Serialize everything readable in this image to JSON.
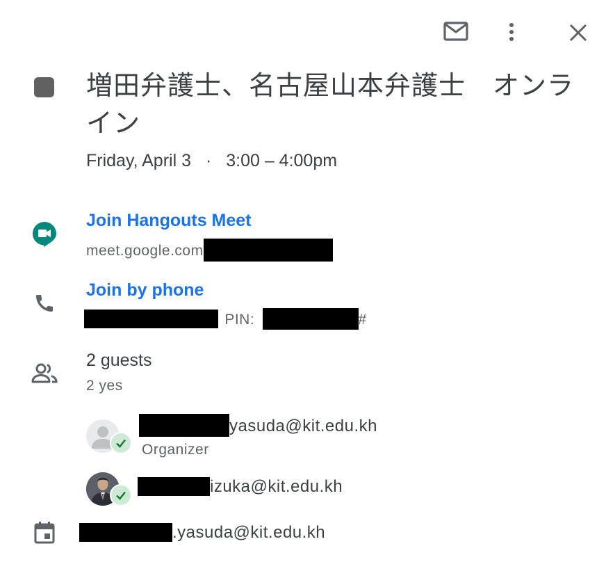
{
  "toolbar": {
    "email_icon": "mail-icon",
    "more_icon": "more-vert-icon",
    "close_icon": "close-icon"
  },
  "event": {
    "color": "#616161",
    "title": "増田弁護士、名古屋山本弁護士　オンライン",
    "date": "Friday, April 3",
    "separator": "·",
    "time": "3:00 – 4:00pm"
  },
  "meet": {
    "icon": "hangouts-meet-icon",
    "label": "Join Hangouts Meet",
    "url_prefix": "meet.google.com"
  },
  "phone": {
    "icon": "phone-icon",
    "label": "Join by phone",
    "pin_label": "PIN:",
    "pin_suffix": "#"
  },
  "guests": {
    "icon": "people-icon",
    "count_label": "2 guests",
    "summary": "2 yes",
    "list": [
      {
        "email_suffix": "yasuda@kit.edu.kh",
        "role": "Organizer",
        "status": "accepted"
      },
      {
        "email_suffix": "izuka@kit.edu.kh",
        "role": "",
        "status": "accepted"
      }
    ]
  },
  "calendar": {
    "icon": "calendar-icon",
    "owner_suffix": ".yasuda@kit.edu.kh"
  },
  "colors": {
    "accent": "#1a73e8",
    "meet_green": "#00897b",
    "check_green": "#188038"
  }
}
